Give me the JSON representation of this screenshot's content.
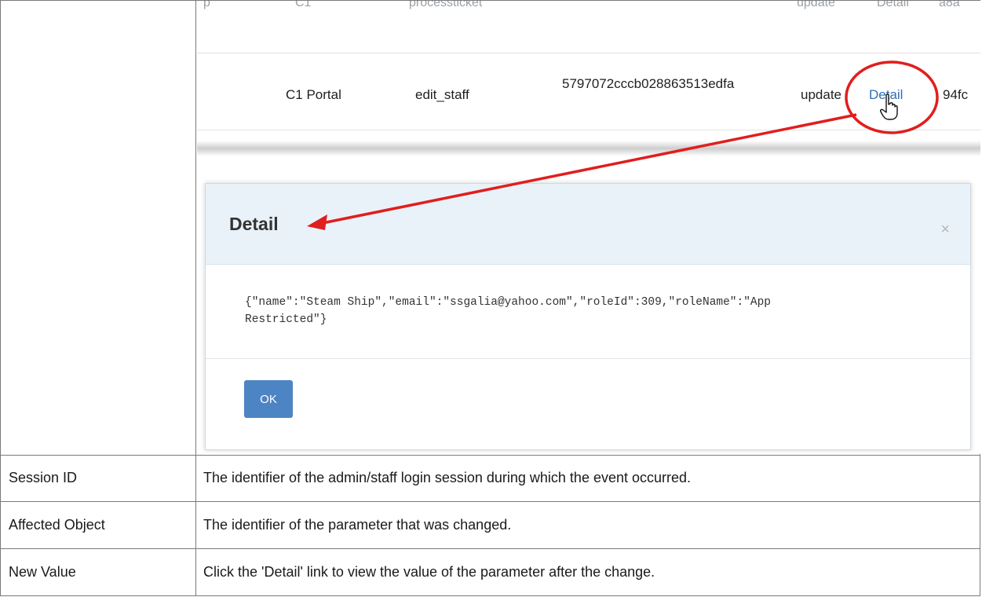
{
  "screenshot": {
    "faded_row": {
      "c1": "p",
      "c2": "C1",
      "c3": "processticket",
      "c4": "update",
      "c5": "Detail",
      "c6": "a8a"
    },
    "row": {
      "source": "C1 Portal",
      "action": "edit_staff",
      "session_id": "5797072cccb028863513edfa",
      "type": "update",
      "detail_link": "Detail",
      "object_fragment": "94fc"
    },
    "modal": {
      "title": "Detail",
      "close_glyph": "×",
      "body_line1": "{\"name\":\"Steam Ship\",\"email\":\"ssgalia@yahoo.com\",\"roleId\":309,\"roleName\":\"App",
      "body_line2": "Restricted\"}",
      "ok_label": "OK"
    },
    "annotation_color": "#e01e1e",
    "cursor_icon": "hand-pointer-icon"
  },
  "rows": [
    {
      "label": "Session ID",
      "description": "The identifier of the admin/staff login session during which the event occurred."
    },
    {
      "label": "Affected Object",
      "description": "The identifier of the parameter that was changed."
    },
    {
      "label": "New Value",
      "description": "Click the 'Detail' link to view the value of the parameter after the change."
    }
  ]
}
